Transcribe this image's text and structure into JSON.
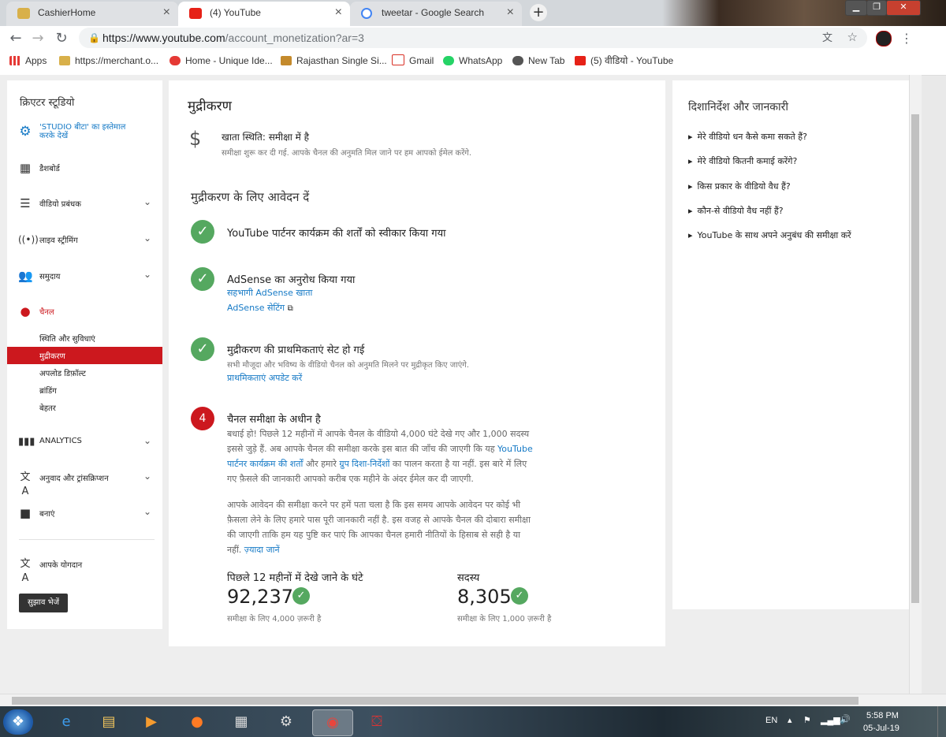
{
  "browser": {
    "tabs": [
      {
        "title": "CashierHome",
        "active": false,
        "favicon": "cashier-favicon"
      },
      {
        "title": "(4) YouTube",
        "active": true,
        "favicon": "youtube-favicon"
      },
      {
        "title": "tweetar - Google Search",
        "active": false,
        "favicon": "google-favicon"
      }
    ],
    "url_domain": "https://www.youtube.com",
    "url_path": "/account_monetization?ar=3",
    "bookmarks": [
      {
        "label": "Apps",
        "icon": "apps-grid-icon"
      },
      {
        "label": "https://merchant.o...",
        "icon": "cashier-favicon"
      },
      {
        "label": "Home - Unique Ide...",
        "icon": "wifi-logo-icon"
      },
      {
        "label": "Rajasthan Single Si...",
        "icon": "emblem-icon"
      },
      {
        "label": "Gmail",
        "icon": "gmail-icon"
      },
      {
        "label": "WhatsApp",
        "icon": "whatsapp-icon"
      },
      {
        "label": "New Tab",
        "icon": "globe-icon"
      },
      {
        "label": "(5) वीडियो - YouTube",
        "icon": "youtube-favicon"
      }
    ]
  },
  "sidebar": {
    "title": "क्रिएटर स्टूडियो",
    "beta": "'STUDIO बीटा' का इस्तेमाल करके देखें",
    "items": [
      {
        "label": "डैशबोर्ड",
        "icon": "dashboard-icon"
      },
      {
        "label": "वीडियो प्रबंधक",
        "icon": "video-manager-icon"
      },
      {
        "label": "लाइव स्ट्रीमिंग",
        "icon": "live-icon"
      },
      {
        "label": "समुदाय",
        "icon": "community-icon"
      },
      {
        "label": "चैनल",
        "icon": "channel-icon"
      }
    ],
    "channel_sub": [
      "स्थिति और सुविधाएं",
      "मुद्रीकरण",
      "अपलोड डिफ़ॉल्ट",
      "ब्रांडिंग",
      "बेहतर"
    ],
    "items2": [
      {
        "label": "ANALYTICS",
        "icon": "analytics-icon"
      },
      {
        "label": "अनुवाद और ट्रांसक्रिप्शन",
        "icon": "translate-icon"
      },
      {
        "label": "बनाएं",
        "icon": "create-icon"
      }
    ],
    "contrib": "आपके योगदान",
    "feedback": "सुझाव भेजें"
  },
  "main": {
    "title": "मुद्रीकरण",
    "status_title": "खाता स्थिति: समीक्षा में है",
    "status_desc": "समीक्षा शुरू कर दी गई. आपके चैनल की अनुमति मिल जाने पर हम आपको ईमेल करेंगे.",
    "apply_heading": "मुद्रीकरण के लिए आवेदन दें",
    "step1": "YouTube पार्टनर कार्यक्रम की शर्तों को स्वीकार किया गया",
    "step2": "AdSense का अनुरोध किया गया",
    "step2_link1": "सहभागी AdSense खाता",
    "step2_link2": "AdSense सेटिंग",
    "step3": "मुद्रीकरण की प्राथमिकताएं सेट हो गई",
    "step3_desc": "सभी मौजूदा और भविष्य के वीडियो चैनल को अनुमति मिलने पर मुद्रीकृत किए जाएंगे.",
    "step3_link": "प्राथमिकताएं अपडेट करें",
    "step4_num": "4",
    "step4": "चैनल समीक्षा के अधीन है",
    "step4_p1a": "बधाई हो! पिछले 12 महीनों में आपके चैनल के वीडियो 4,000 घंटे देखे गए और 1,000 सदस्य",
    "step4_p1b": "इससे जुड़े हैं. अब आपके चैनल की समीक्षा करके इस बात की जाँच की जाएगी कि यह",
    "step4_p1_link1a": "YouTube",
    "step4_p1_link1b": "पार्टनर कार्यक्रम की शर्तों",
    "step4_p1c": "और हमारे",
    "step4_p1_link2": "ग्रुप दिशा-निर्देशों",
    "step4_p1d": "का पालन करता है या नहीं. इस बारे में लिए",
    "step4_p1e": "गए फ़ैसले की जानकारी आपको करीब एक महीने के अंदर ईमेल कर दी जाएगी.",
    "step4_p2a": "आपके आवेदन की समीक्षा करने पर हमें पता चला है कि इस समय आपके आवेदन पर कोई भी",
    "step4_p2b": "फ़ैसला लेने के लिए हमारे पास पूरी जानकारी नहीं है. इस वजह से आपके चैनल की दोबारा समीक्षा",
    "step4_p2c": "की जाएगी ताकि हम यह पुष्टि कर पाएं कि आपका चैनल हमारी नीतियों के हिसाब से सही है या",
    "step4_p2d": "नहीं.",
    "step4_more": "ज़्यादा जानें",
    "stat1_label": "पिछले 12 महीनों में देखे जाने के घंटे",
    "stat1_value": "92,237",
    "stat1_req": "समीक्षा के लिए 4,000 ज़रूरी है",
    "stat2_label": "सदस्य",
    "stat2_value": "8,305",
    "stat2_req": "समीक्षा के लिए 1,000 ज़रूरी है"
  },
  "right": {
    "title": "दिशानिर्देश और जानकारी",
    "links": [
      "मेरे वीडियो धन कैसे कमा सकते हैं?",
      "मेरे वीडियो कितनी कमाई करेंगे?",
      "किस प्रकार के वीडियो वैध हैं?",
      "कौन-से वीडियो वैध नहीं हैं?",
      "YouTube के साथ अपने अनुबंध की समीक्षा करें"
    ]
  },
  "taskbar": {
    "lang": "EN",
    "time": "5:58 PM",
    "date": "05-Jul-19"
  },
  "colors": {
    "accent_red": "#cc181e",
    "check_green": "#55a860",
    "link_blue": "#167ac6"
  }
}
